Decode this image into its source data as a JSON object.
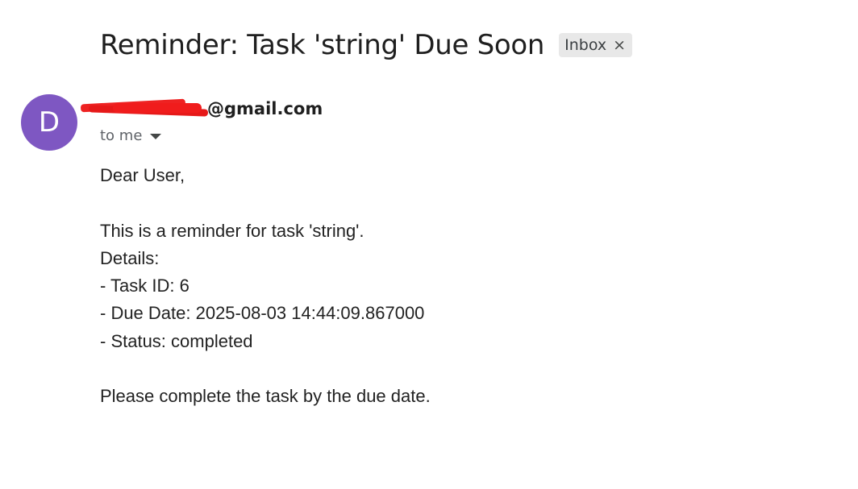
{
  "email": {
    "subject": "Reminder: Task 'string' Due Soon",
    "label": "Inbox",
    "label_remove_icon": "×",
    "sender_initial": "D",
    "sender_email_visible": "@gmail.com",
    "recipient": "to me",
    "body_lines": [
      "Dear User,",
      "",
      "This is a reminder for task 'string'.",
      "Details:",
      "- Task ID: 6",
      "- Due Date: 2025-08-03 14:44:09.867000",
      "- Status: completed",
      "",
      "Please complete the task by the due date."
    ]
  },
  "colors": {
    "avatar_bg": "#7e57c2",
    "redaction": "#ee2222",
    "chip_bg": "#e8e8e8"
  },
  "icons": {
    "chip_close": "close-icon",
    "recipient_dropdown": "chevron-down-icon"
  }
}
